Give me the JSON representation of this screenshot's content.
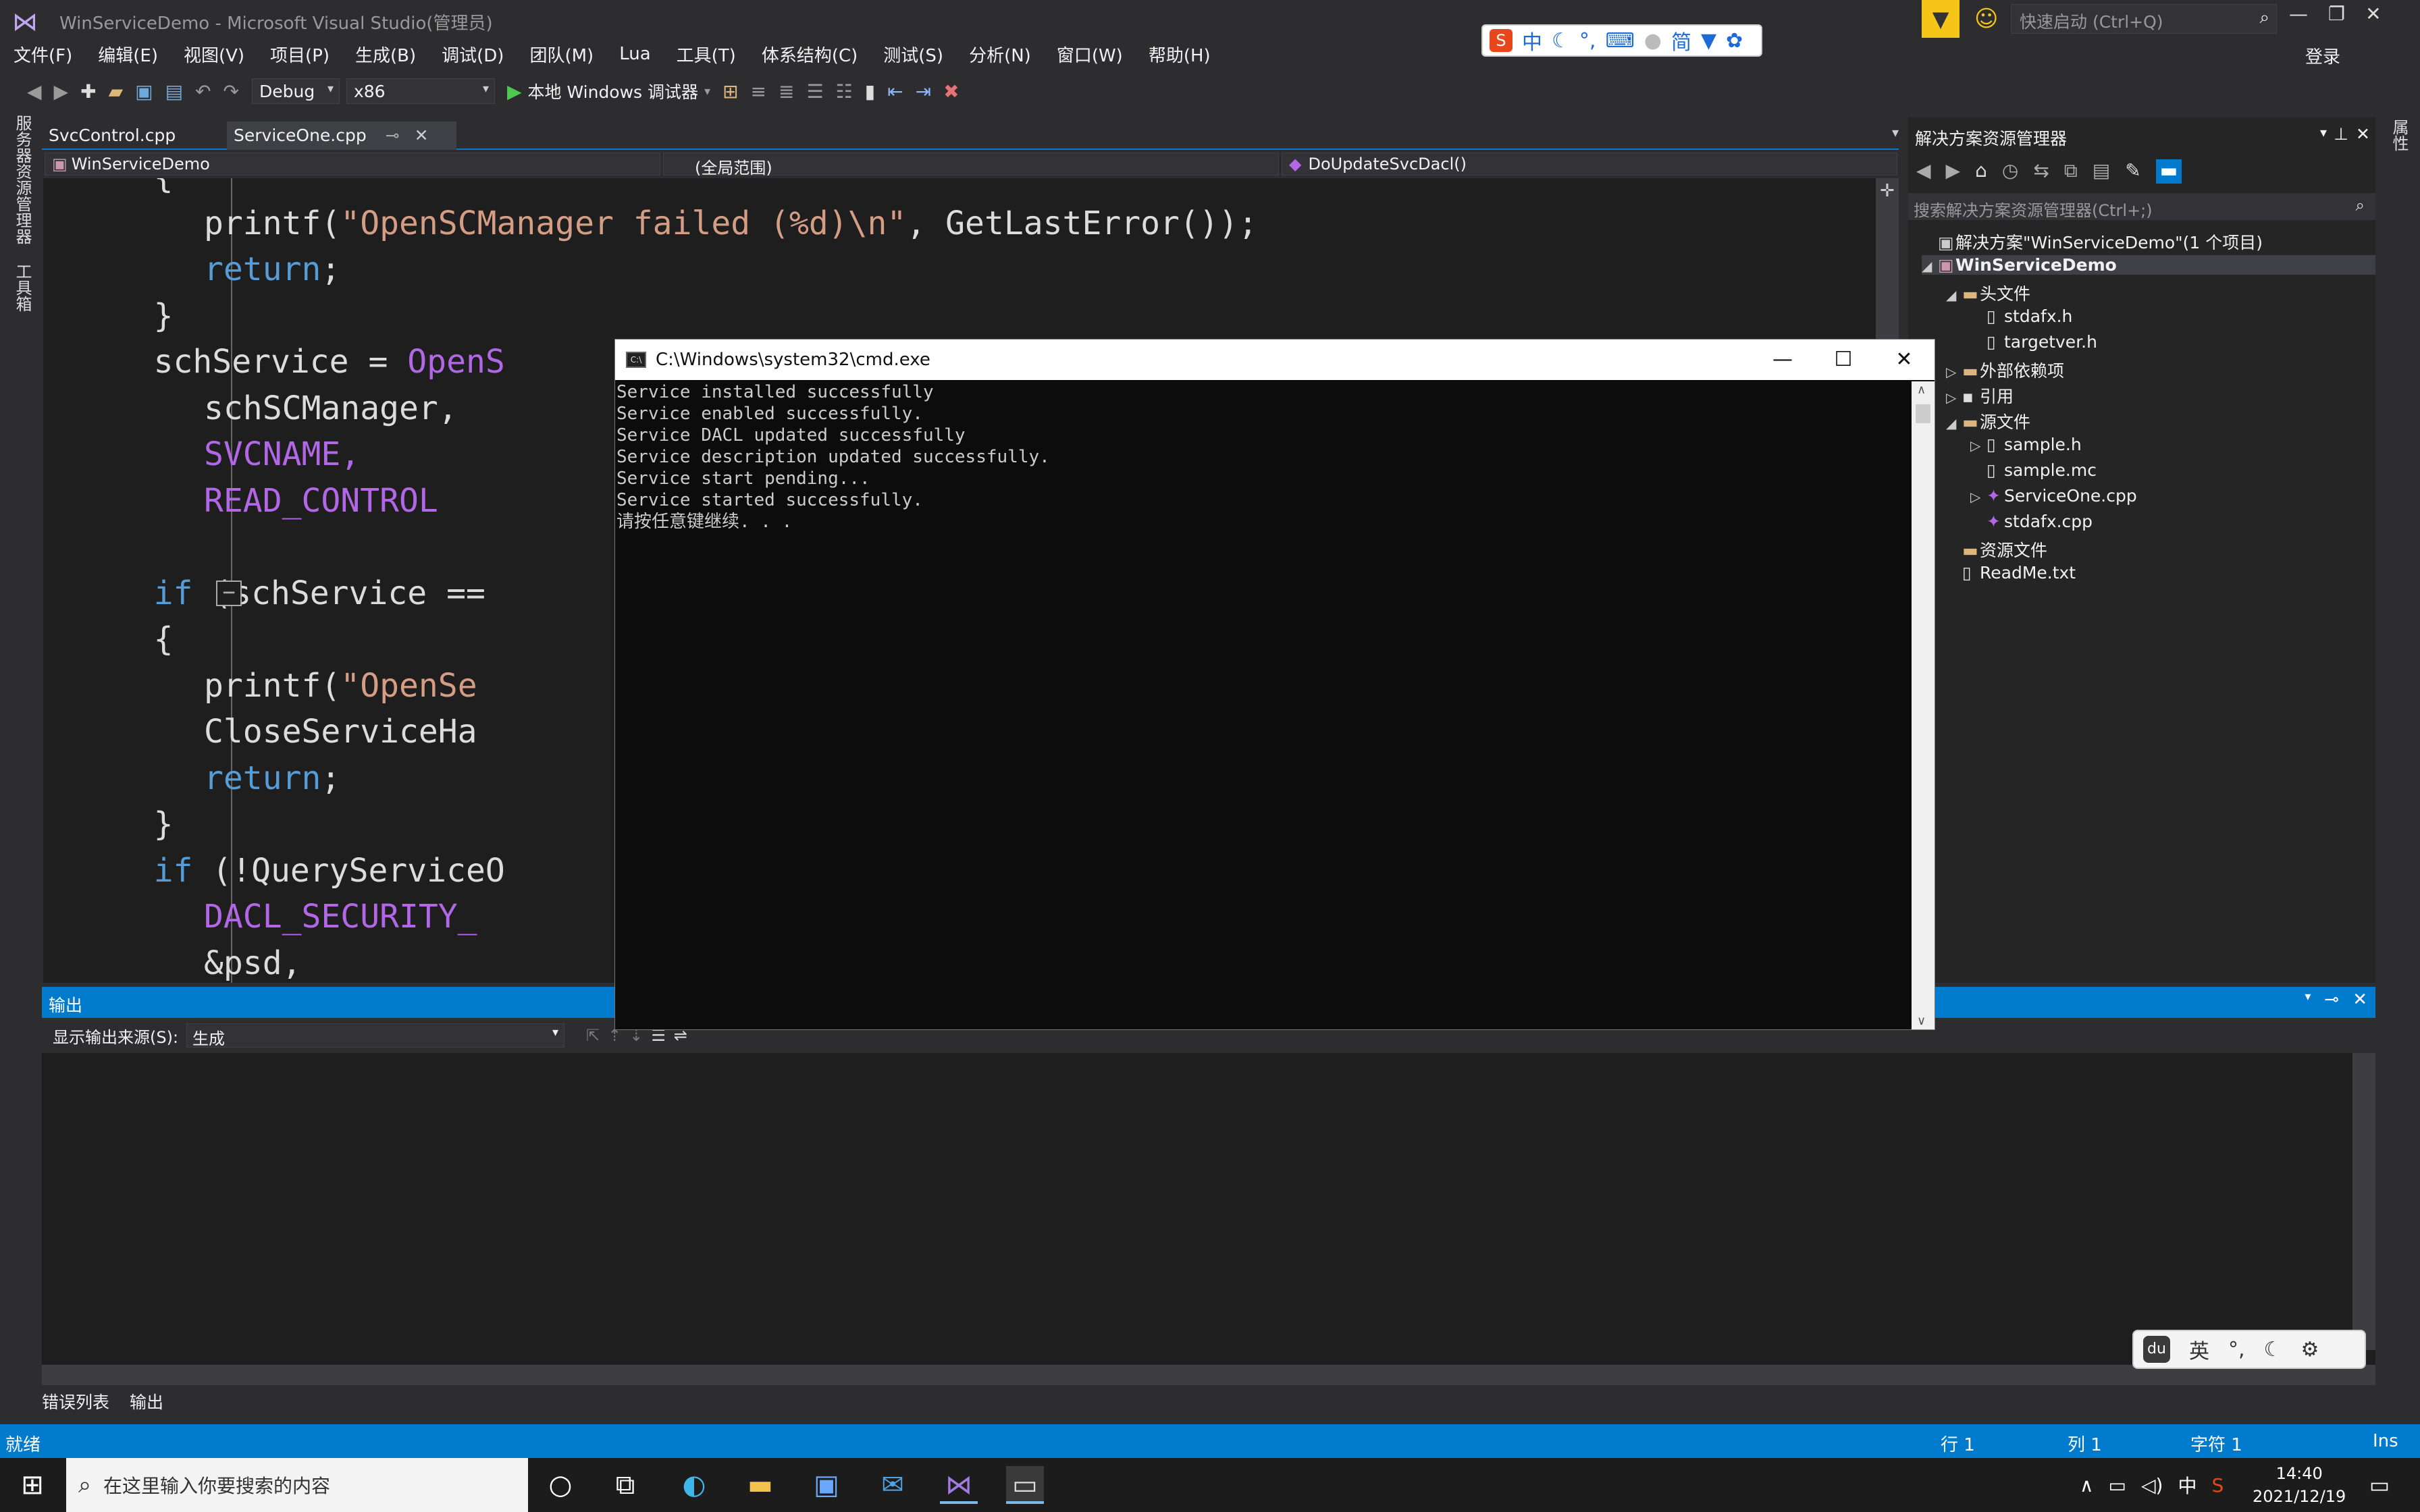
{
  "window": {
    "title": "WinServiceDemo - Microsoft Visual Studio(管理员)"
  },
  "menu": [
    "文件(F)",
    "编辑(E)",
    "视图(V)",
    "项目(P)",
    "生成(B)",
    "调试(D)",
    "团队(M)",
    "Lua",
    "工具(T)",
    "体系结构(C)",
    "测试(S)",
    "分析(N)",
    "窗口(W)",
    "帮助(H)"
  ],
  "toolbar": {
    "config": "Debug",
    "platform": "x86",
    "debugger": "本地 Windows 调试器"
  },
  "quick_launch": {
    "placeholder": "快速启动 (Ctrl+Q)"
  },
  "login": "登录",
  "ime_top": [
    "中",
    "简"
  ],
  "left_strip": [
    "服务器资源管理器",
    "工具箱"
  ],
  "editor": {
    "tabs": [
      {
        "label": "SvcControl.cpp"
      },
      {
        "label": "ServiceOne.cpp"
      }
    ],
    "nav": {
      "project": "WinServiceDemo",
      "scope": "(全局范围)",
      "function": "DoUpdateSvcDacl()"
    },
    "lines": [
      {
        "parts": [
          {
            "t": "{",
            "c": "#dcdcdc"
          }
        ]
      },
      {
        "parts": [
          {
            "t": "printf(",
            "c": "#dcdcdc"
          },
          {
            "t": "\"OpenSCManager failed (%d)\\n\"",
            "c": "#d69d85"
          },
          {
            "t": ", GetLastError());",
            "c": "#dcdcdc"
          }
        ]
      },
      {
        "parts": [
          {
            "t": "return",
            "c": "#569cd6"
          },
          {
            "t": ";",
            "c": "#dcdcdc"
          }
        ]
      },
      {
        "parts": [
          {
            "t": "}",
            "c": "#dcdcdc"
          }
        ]
      },
      {
        "parts": [
          {
            "t": "schService = ",
            "c": "#dcdcdc"
          },
          {
            "t": "OpenS",
            "c": "#b267e6"
          }
        ]
      },
      {
        "parts": [
          {
            "t": "schSCManager,",
            "c": "#dcdcdc"
          }
        ]
      },
      {
        "parts": [
          {
            "t": "SVCNAME,",
            "c": "#b267e6"
          }
        ]
      },
      {
        "parts": [
          {
            "t": "READ_CONTROL",
            "c": "#b267e6"
          }
        ]
      },
      {
        "parts": [
          {
            "t": "",
            "c": "#dcdcdc"
          }
        ]
      },
      {
        "parts": [
          {
            "t": "if",
            "c": "#569cd6"
          },
          {
            "t": " (schService ==",
            "c": "#dcdcdc"
          }
        ]
      },
      {
        "parts": [
          {
            "t": "{",
            "c": "#dcdcdc"
          }
        ]
      },
      {
        "parts": [
          {
            "t": "printf(",
            "c": "#dcdcdc"
          },
          {
            "t": "\"OpenSe",
            "c": "#d69d85"
          }
        ]
      },
      {
        "parts": [
          {
            "t": "CloseServiceHa",
            "c": "#dcdcdc"
          }
        ]
      },
      {
        "parts": [
          {
            "t": "return",
            "c": "#569cd6"
          },
          {
            "t": ";",
            "c": "#dcdcdc"
          }
        ]
      },
      {
        "parts": [
          {
            "t": "}",
            "c": "#dcdcdc"
          }
        ]
      },
      {
        "parts": [
          {
            "t": "if",
            "c": "#569cd6"
          },
          {
            "t": " (!QueryServiceO",
            "c": "#dcdcdc"
          }
        ]
      },
      {
        "parts": [
          {
            "t": "DACL_SECURITY_",
            "c": "#b267e6"
          }
        ]
      },
      {
        "parts": [
          {
            "t": "&psd,",
            "c": "#dcdcdc"
          }
        ]
      }
    ]
  },
  "solution_explorer": {
    "title": "解决方案资源管理器",
    "search_placeholder": "搜索解决方案资源管理器(Ctrl+;)",
    "items": [
      {
        "label": "解决方案\"WinServiceDemo\"(1 个项目)",
        "level": 0,
        "tri": "",
        "icon": "solution-icon",
        "bold": false
      },
      {
        "label": "WinServiceDemo",
        "level": 0,
        "tri": "◢",
        "icon": "project-icon",
        "bold": true
      },
      {
        "label": "头文件",
        "level": 1,
        "tri": "◢",
        "icon": "folder-icon",
        "bold": false
      },
      {
        "label": "stdafx.h",
        "level": 2,
        "tri": "",
        "icon": "file-icon",
        "bold": false
      },
      {
        "label": "targetver.h",
        "level": 2,
        "tri": "",
        "icon": "file-icon",
        "bold": false
      },
      {
        "label": "外部依赖项",
        "level": 1,
        "tri": "▷",
        "icon": "folder-icon",
        "bold": false
      },
      {
        "label": "引用",
        "level": 1,
        "tri": "▷",
        "icon": "reference-icon",
        "bold": false
      },
      {
        "label": "源文件",
        "level": 1,
        "tri": "◢",
        "icon": "folder-icon",
        "bold": false
      },
      {
        "label": "sample.h",
        "level": 2,
        "tri": "▷",
        "icon": "file-icon",
        "bold": false
      },
      {
        "label": "sample.mc",
        "level": 2,
        "tri": "",
        "icon": "file-icon",
        "bold": false
      },
      {
        "label": "ServiceOne.cpp",
        "level": 2,
        "tri": "▷",
        "icon": "cpp-file-icon",
        "bold": false
      },
      {
        "label": "stdafx.cpp",
        "level": 2,
        "tri": "",
        "icon": "cpp-file-icon",
        "bold": false
      },
      {
        "label": "资源文件",
        "level": 1,
        "tri": "",
        "icon": "folder-icon",
        "bold": false
      },
      {
        "label": "ReadMe.txt",
        "level": 1,
        "tri": "",
        "icon": "file-icon",
        "bold": false
      }
    ]
  },
  "output": {
    "title": "输出",
    "source_label": "显示输出来源(S):",
    "source_value": "生成"
  },
  "bottom_tabs": [
    "错误列表",
    "输出"
  ],
  "status": {
    "ready": "就绪",
    "line": "行 1",
    "col": "列 1",
    "char": "字符 1",
    "ins": "Ins"
  },
  "cmd": {
    "title": "C:\\Windows\\system32\\cmd.exe",
    "lines": [
      "Service installed successfully",
      "Service enabled successfully.",
      "Service DACL updated successfully",
      "Service description updated successfully.",
      "Service start pending...",
      "Service started successfully.",
      "请按任意键继续. . ."
    ]
  },
  "taskbar": {
    "search_placeholder": "在这里输入你要搜索的内容",
    "ime_tray": "中",
    "time": "14:40",
    "date": "2021/12/19"
  },
  "ime_float": [
    "英"
  ],
  "colors": {
    "accent": "#007acc",
    "editor_bg": "#1e1e1e",
    "chrome_bg": "#2d2d30"
  }
}
